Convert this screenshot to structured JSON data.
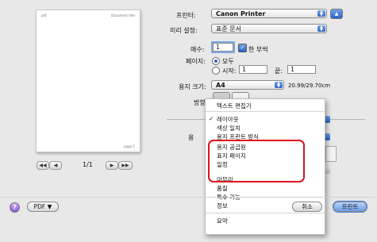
{
  "preview": {
    "header_left": "pdf",
    "header_right": "Document title",
    "footer_right": "page 1",
    "page_indicator": "1/1",
    "nav_first": "◀◀",
    "nav_prev": "◀",
    "nav_next": "▶",
    "nav_last": "▶▶"
  },
  "form": {
    "printer_label": "프린터:",
    "printer_value": "Canon Printer",
    "presets_label": "미리 설정:",
    "presets_value": "표준 문서",
    "copies_label": "매수:",
    "copies_value": "1",
    "collated_label": "한 부씩",
    "pages_label": "페이지:",
    "pages_all": "모두",
    "pages_from": "시작:",
    "pages_from_value": "1",
    "pages_to": "끝:",
    "pages_to_value": "1",
    "paper_label": "용지 크기:",
    "paper_value": "A4",
    "paper_dims": "20.99/29.70cm",
    "orientation_label": "방향",
    "left_trunc": "용"
  },
  "menu": {
    "items": [
      "텍스트 편집기",
      "레이아웃",
      "색상 일치",
      "용지 프린트 방식",
      "용지 공급원",
      "표지 페이지",
      "일정",
      "마무리",
      "품질",
      "특수 기능",
      "정보",
      "요약"
    ],
    "checked": "레이아웃"
  },
  "buttons": {
    "help": "?",
    "pdf": "PDF ▼",
    "cancel": "취소",
    "print": "프린트"
  },
  "colors": {
    "highlight_box": "#e0121b",
    "accent": "#2b63c8"
  }
}
